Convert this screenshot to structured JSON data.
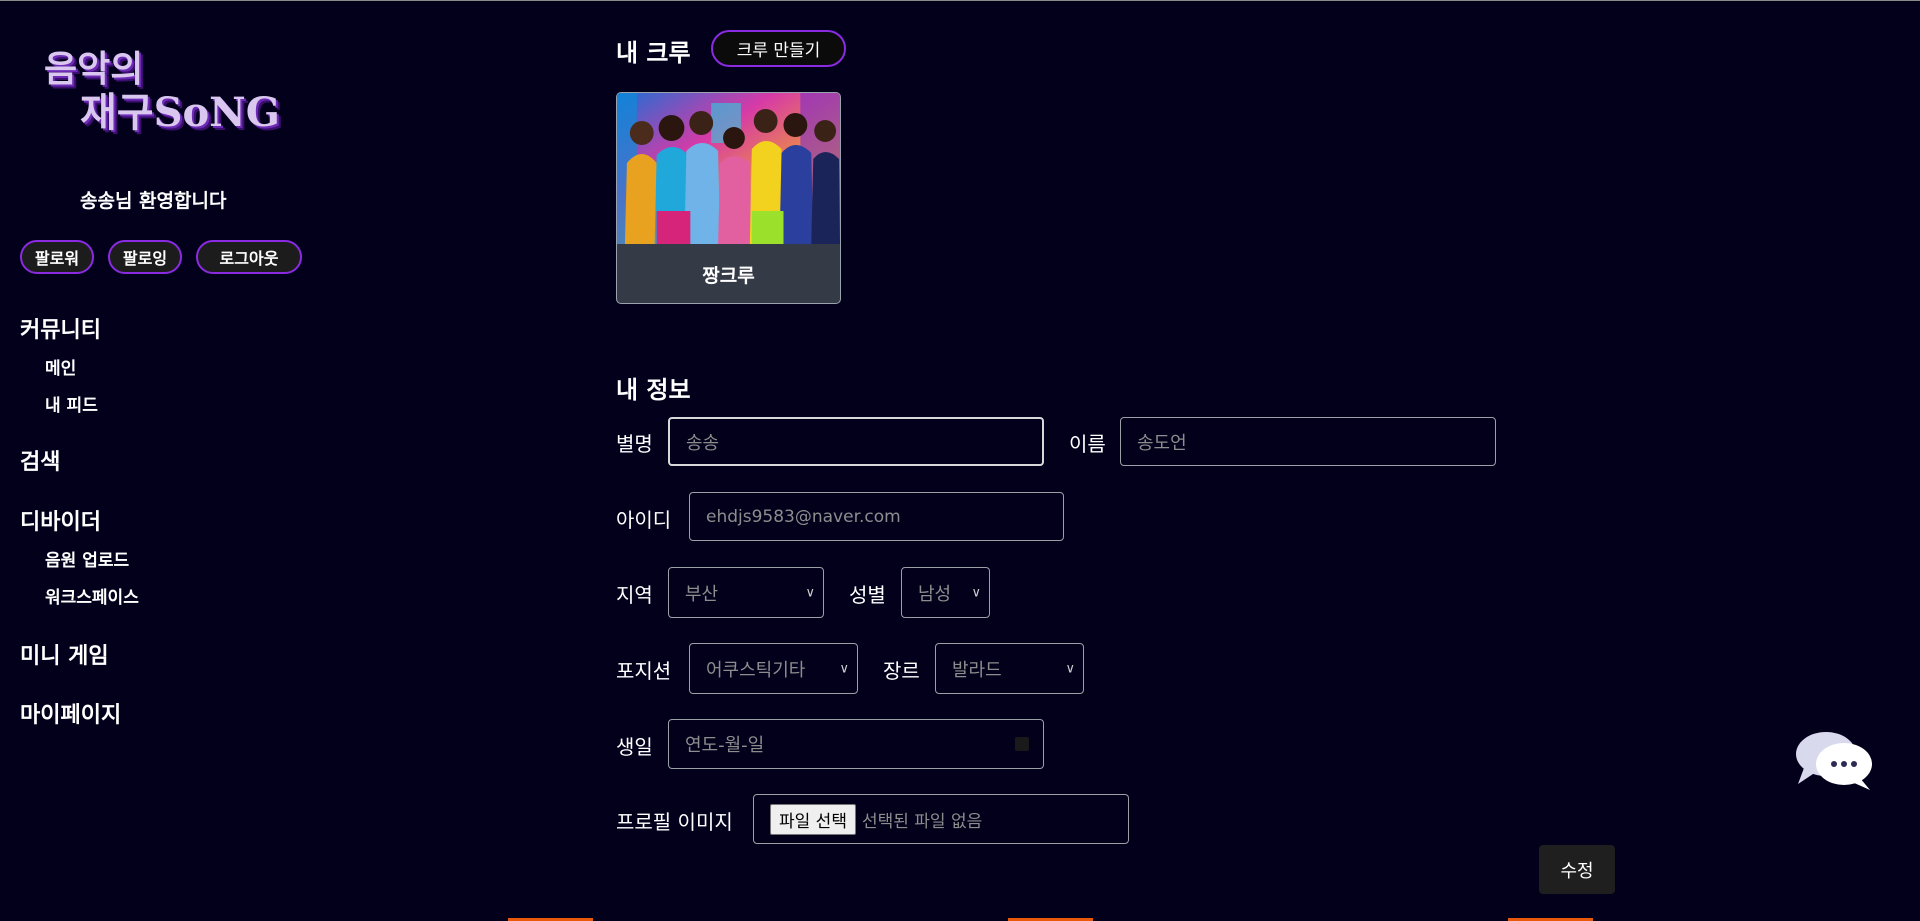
{
  "sidebar": {
    "logo_line1": "음악의",
    "logo_line2": "재구SoNG",
    "welcome": "송송님 환영합니다",
    "buttons": {
      "followers": "팔로워",
      "following": "팔로잉",
      "logout": "로그아웃"
    },
    "nav": {
      "community": {
        "label": "커뮤니티",
        "items": [
          "메인",
          "내 피드"
        ]
      },
      "search": {
        "label": "검색"
      },
      "divider": {
        "label": "디바이더",
        "items": [
          "음원 업로드",
          "워크스페이스"
        ]
      },
      "minigame": {
        "label": "미니 게임"
      },
      "mypage": {
        "label": "마이페이지"
      }
    }
  },
  "crew": {
    "title": "내 크루",
    "create_label": "크루 만들기",
    "cards": [
      {
        "name": "짱크루"
      }
    ]
  },
  "info": {
    "title": "내 정보",
    "nickname": {
      "label": "별명",
      "placeholder": "송송"
    },
    "name": {
      "label": "이름",
      "placeholder": "송도언"
    },
    "user_id": {
      "label": "아이디",
      "value": "ehdjs9583@naver.com"
    },
    "region": {
      "label": "지역",
      "selected": "부산"
    },
    "gender": {
      "label": "성별",
      "selected": "남성"
    },
    "position": {
      "label": "포지션",
      "selected": "어쿠스틱기타"
    },
    "genre": {
      "label": "장르",
      "selected": "발라드"
    },
    "birthday": {
      "label": "생일",
      "placeholder": "연도-월-일"
    },
    "profile_image": {
      "label": "프로필 이미지",
      "button": "파일 선택",
      "status": "선택된 파일 없음"
    },
    "submit": "수정"
  },
  "colors": {
    "background": "#03001c",
    "accent": "#8a2be2"
  },
  "icons": {
    "chat": "chat-bubbles-icon",
    "calendar": "calendar-icon",
    "chevron": "chevron-down-icon"
  }
}
